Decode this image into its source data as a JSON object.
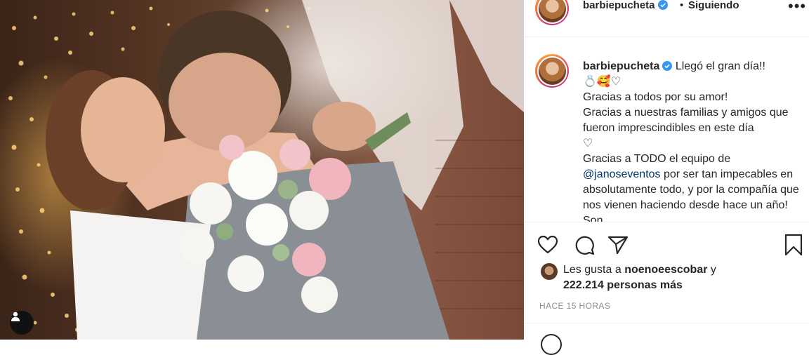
{
  "post": {
    "username": "barbiepucheta",
    "separator": "•",
    "follow_status": "Siguiendo",
    "more_label": "•••"
  },
  "caption": {
    "username": "barbiepucheta",
    "line1": "Llegó el gran día!!",
    "emojis": "💍🥰♡",
    "line2": "Gracias a todos por su amor!",
    "line3": "Gracias a nuestras familias y amigos que fueron imprescindibles en este día",
    "heart": "♡",
    "line4_prefix": "Gracias a TODO el equipo de",
    "mention": "@janoseventos",
    "line4_suffix": "por ser tan impecables en absolutamente todo, y por la compañía que nos vienen haciendo desde hace un año! Son"
  },
  "likes": {
    "prefix": "Les gusta a",
    "user": "noenoeescobar",
    "conj": "y",
    "count_text": "222.214 personas más"
  },
  "timestamp": "HACE 15 HORAS",
  "icons": {
    "like": "heart-outline-icon",
    "comment": "comment-bubble-icon",
    "share": "paper-plane-icon",
    "save": "bookmark-icon",
    "verified": "verified-badge-icon",
    "user_tags": "user-tag-icon"
  },
  "colors": {
    "verified_blue": "#3897f0",
    "mention_blue": "#00376b",
    "muted": "#8e8e8e",
    "text": "#262626"
  }
}
